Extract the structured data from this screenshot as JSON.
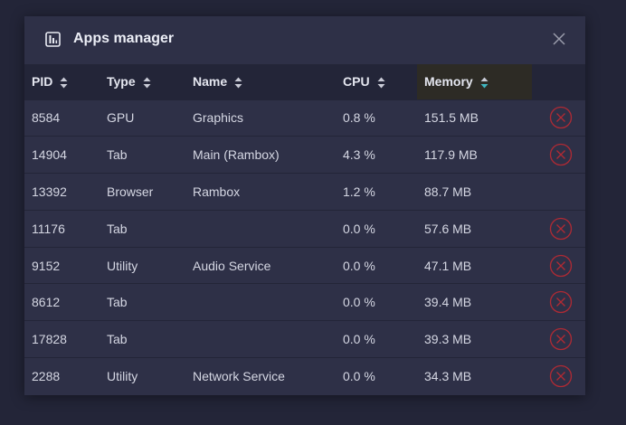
{
  "dialog": {
    "title": "Apps manager",
    "title_icon": "bar-chart-icon",
    "close_icon": "close-icon"
  },
  "table": {
    "columns": [
      {
        "key": "pid",
        "label": "PID",
        "sortable": true
      },
      {
        "key": "type",
        "label": "Type",
        "sortable": true
      },
      {
        "key": "name",
        "label": "Name",
        "sortable": true
      },
      {
        "key": "cpu",
        "label": "CPU",
        "sortable": true
      },
      {
        "key": "memory",
        "label": "Memory",
        "sortable": true,
        "sorted": "desc"
      }
    ],
    "rows": [
      {
        "pid": "8584",
        "type": "GPU",
        "name": "Graphics",
        "cpu": "0.8 %",
        "memory": "151.5 MB",
        "killable": true
      },
      {
        "pid": "14904",
        "type": "Tab",
        "name": "Main (Rambox)",
        "cpu": "4.3 %",
        "memory": "117.9 MB",
        "killable": true
      },
      {
        "pid": "13392",
        "type": "Browser",
        "name": "Rambox",
        "cpu": "1.2 %",
        "memory": "88.7 MB",
        "killable": false
      },
      {
        "pid": "11176",
        "type": "Tab",
        "name": "",
        "cpu": "0.0 %",
        "memory": "57.6 MB",
        "killable": true
      },
      {
        "pid": "9152",
        "type": "Utility",
        "name": "Audio Service",
        "cpu": "0.0 %",
        "memory": "47.1 MB",
        "killable": true
      },
      {
        "pid": "8612",
        "type": "Tab",
        "name": "",
        "cpu": "0.0 %",
        "memory": "39.4 MB",
        "killable": true
      },
      {
        "pid": "17828",
        "type": "Tab",
        "name": "",
        "cpu": "0.0 %",
        "memory": "39.3 MB",
        "killable": true
      },
      {
        "pid": "2288",
        "type": "Utility",
        "name": "Network Service",
        "cpu": "0.0 %",
        "memory": "34.3 MB",
        "killable": true
      }
    ],
    "kill_icon": "circle-x-icon"
  },
  "colors": {
    "backdrop": "#232538",
    "panel": "#2e3047",
    "header_row": "#232538",
    "sorted_header": "#2d2b25",
    "kill_accent": "#b02a34",
    "sort_active": "#3fb5c0"
  }
}
